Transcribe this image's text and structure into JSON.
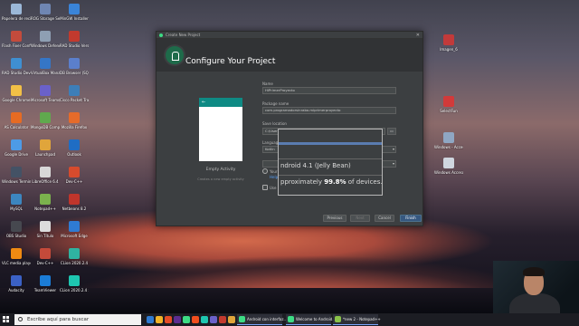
{
  "desktop": {
    "icons_left": [
      {
        "label": "Papelera de reciclaje",
        "color": "#9bb8d8"
      },
      {
        "label": "ROG Storage Server",
        "color": "#6f86b2"
      },
      {
        "label": "MinGW Installer",
        "color": "#3a84d8"
      },
      {
        "label": "Flash Fixer Configuration",
        "color": "#c34b3c"
      },
      {
        "label": "Windows Defender Fi...",
        "color": "#8e9fb3"
      },
      {
        "label": "RAD Studio Version...",
        "color": "#c23a2e"
      },
      {
        "label": "RAD Studio Developer",
        "color": "#3f8fd1"
      },
      {
        "label": "VirtualBox Manager",
        "color": "#3576c6"
      },
      {
        "label": "DB Browser (SQLite)",
        "color": "#5b7fcc"
      },
      {
        "label": "Google Chrome",
        "color": "#f2c046"
      },
      {
        "label": "Microsoft Teams",
        "color": "#6a61c9"
      },
      {
        "label": "Cisco Packet Tracer",
        "color": "#3d7eb8"
      },
      {
        "label": "AS Calculator",
        "color": "#e66b23"
      },
      {
        "label": "MongoDB Compass",
        "color": "#60a94e"
      },
      {
        "label": "Mozilla Firefox",
        "color": "#e66b2a"
      },
      {
        "label": "Google Drive",
        "color": "#4d9be6"
      },
      {
        "label": "Launchpad",
        "color": "#e0a53b"
      },
      {
        "label": "Outlook",
        "color": "#1f6dc4"
      },
      {
        "label": "Windows Terminal",
        "color": "#445265"
      },
      {
        "label": "LibreOffice 6.4",
        "color": "#d8d8d8"
      },
      {
        "label": "Dev-C++",
        "color": "#d64b2d"
      },
      {
        "label": "MySQL",
        "color": "#3c86bf"
      },
      {
        "label": "Notepad++",
        "color": "#7bb24d"
      },
      {
        "label": "Netbeans 8.2",
        "color": "#c0352b"
      },
      {
        "label": "OBS Studio",
        "color": "#46484f"
      },
      {
        "label": "Sin Título",
        "color": "#dcdcdc"
      },
      {
        "label": "Microsoft Edge",
        "color": "#2f7bd3"
      },
      {
        "label": "VLC media player",
        "color": "#f08a12"
      },
      {
        "label": "Dev-C++",
        "color": "#c44a3a"
      },
      {
        "label": "CLion 2020.2.4",
        "color": "#2fb3a1"
      },
      {
        "label": "Audacity",
        "color": "#3b61c5"
      },
      {
        "label": "TeamViewer",
        "color": "#1b7cd6"
      },
      {
        "label": "CLion 2020.2.4 x64",
        "color": "#1ec6b0"
      }
    ],
    "icons_right": [
      {
        "label": "Imagen_6",
        "color": "#c23a3a"
      },
      {
        "label": "SelectFun",
        "color": "#d23a3a"
      },
      {
        "label": "Windows - Acceso directo",
        "color": "#8fa7c4"
      },
      {
        "label": "Windows Acceso directo",
        "color": "#cfd6df"
      }
    ]
  },
  "dialog": {
    "window_title": "Create New Project",
    "heading": "Configure Your Project",
    "activity_title": "Empty Activity",
    "activity_desc": "Creates a new empty activity",
    "fields": {
      "name_label": "Name",
      "name_value": "HiPrimerProyecto",
      "package_label": "Package name",
      "package_value": "com.programadorsinrabo.miprimerproyecto",
      "save_label": "Save location",
      "save_value": "C:\\User",
      "language_label": "Language",
      "language_value": "Kotlin",
      "minapi_label": "Minimum",
      "radio1_label": "Your",
      "radio1_sub": "Help",
      "radio2_label": "Use"
    },
    "tooltip": {
      "api": "ndroid 4.1 (Jelly Bean)",
      "coverage_prefix": "pproximately ",
      "coverage_value": "99.8%",
      "coverage_suffix": " of devices."
    },
    "buttons": {
      "previous": "Previous",
      "next": "Next",
      "cancel": "Cancel",
      "finish": "Finish"
    }
  },
  "taskbar": {
    "search_placeholder": "Escribe aquí para buscar",
    "apps": [
      {
        "label": "Android con interfaz...",
        "color": "#3ddc84"
      },
      {
        "label": "Welcome to Android...",
        "color": "#3ddc84"
      },
      {
        "label": "*new 2 - Notepad++",
        "color": "#8bc34a"
      }
    ],
    "pinned_colors": [
      "#2e7ad1",
      "#f0b429",
      "#e34c26",
      "#5c2d91",
      "#3ddc84",
      "#f24e1e",
      "#1ec6b0",
      "#6a61c9",
      "#c23a2e",
      "#e0a53b"
    ]
  }
}
